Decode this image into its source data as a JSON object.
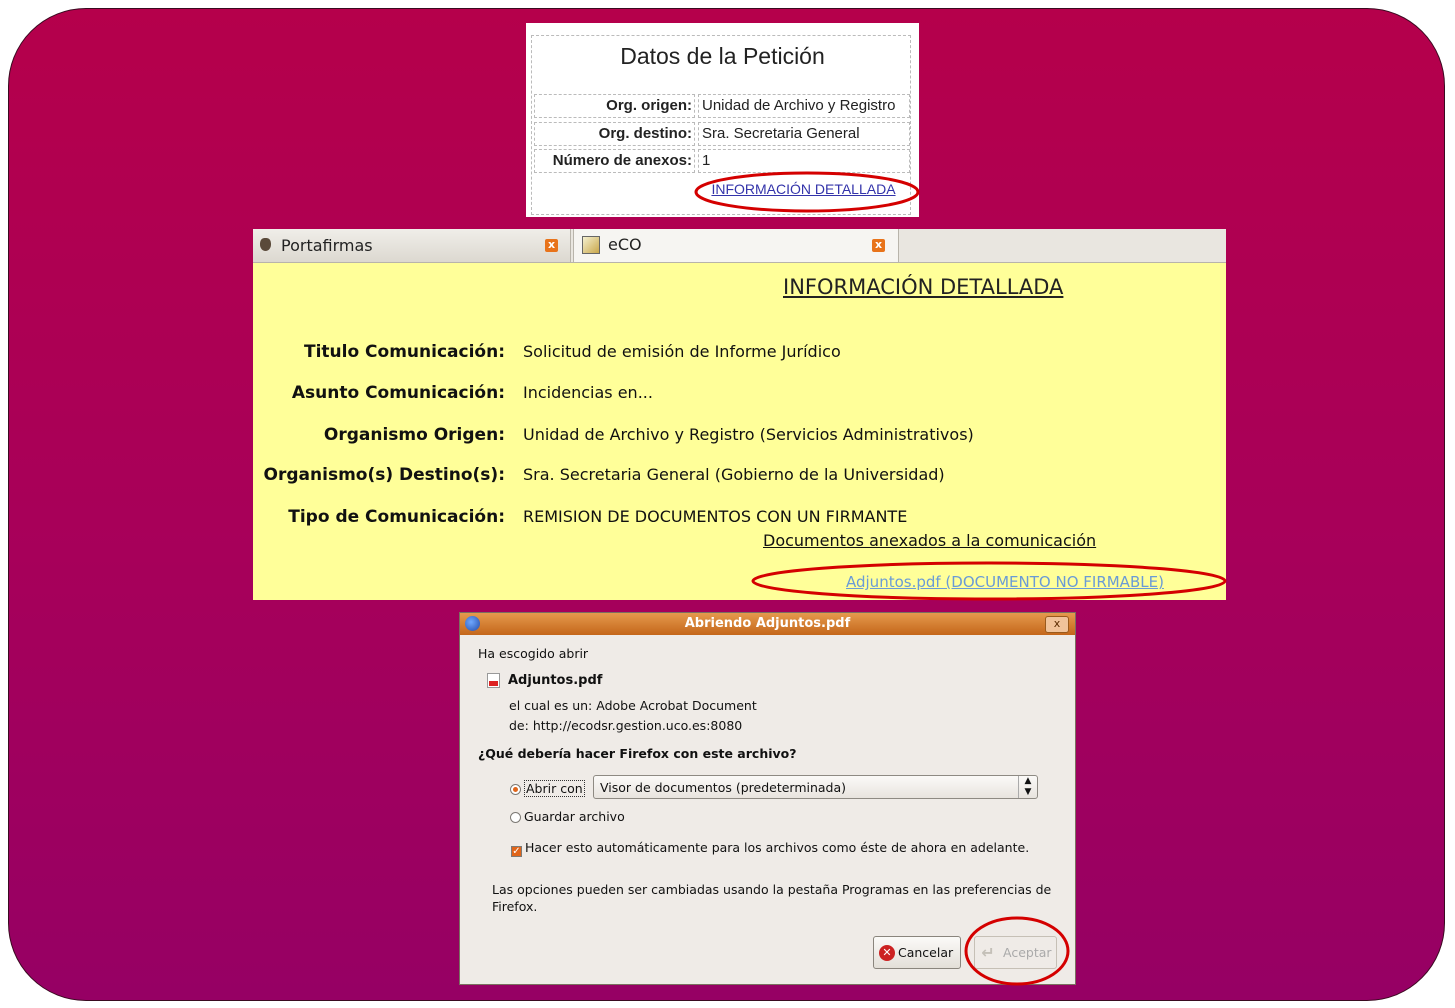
{
  "peticion": {
    "title": "Datos de la Petición",
    "rows": [
      {
        "label": "Org. origen:",
        "value": "Unidad de Archivo y Registro"
      },
      {
        "label": "Org. destino:",
        "value": "Sra. Secretaria General"
      },
      {
        "label": "Número de anexos:",
        "value": "1"
      }
    ],
    "link": "INFORMACIÓN DETALLADA"
  },
  "browser": {
    "tabs": [
      {
        "label": "Portafirmas",
        "close": "x"
      },
      {
        "label": "eCO",
        "close": "x"
      }
    ],
    "heading": "INFORMACIÓN DETALLADA",
    "fields": [
      {
        "label": "Titulo Comunicación:",
        "value": "Solicitud de emisión de Informe Jurídico"
      },
      {
        "label": "Asunto Comunicación:",
        "value": "Incidencias en..."
      },
      {
        "label": "Organismo Origen:",
        "value": "Unidad de Archivo y Registro (Servicios Administrativos)"
      },
      {
        "label": "Organismo(s) Destino(s):",
        "value": "Sra. Secretaria General (Gobierno de la Universidad)"
      },
      {
        "label": "Tipo de Comunicación:",
        "value": "REMISION DE DOCUMENTOS CON UN FIRMANTE"
      }
    ],
    "docs_link": "Documentos anexados a la comunicación",
    "attachment_link": "Adjuntos.pdf (DOCUMENTO NO FIRMABLE)"
  },
  "dialog": {
    "title": "Abriendo Adjuntos.pdf",
    "intro": "Ha escogido abrir",
    "filename": "Adjuntos.pdf",
    "type_prefix": "el cual es un:",
    "type_value": "Adobe Acrobat Document",
    "from_prefix": "de:",
    "from_value": "http://ecodsr.gestion.uco.es:8080",
    "question": "¿Qué debería hacer Firefox con este archivo?",
    "open_with_label": "Abrir con",
    "open_with_selected": "Visor de documentos (predeterminada)",
    "save_label": "Guardar archivo",
    "auto_label": "Hacer esto automáticamente para los archivos como éste de ahora en adelante.",
    "note": "Las opciones pueden ser cambiadas usando la pestaña Programas en las preferencias de Firefox.",
    "cancel_label": "Cancelar",
    "accept_label": "Aceptar",
    "close_glyph": "x"
  },
  "colors": {
    "background_top": "#b5004b",
    "background_bottom": "#960064",
    "content_yellow": "#ffff99",
    "highlight_red": "#d40000"
  }
}
